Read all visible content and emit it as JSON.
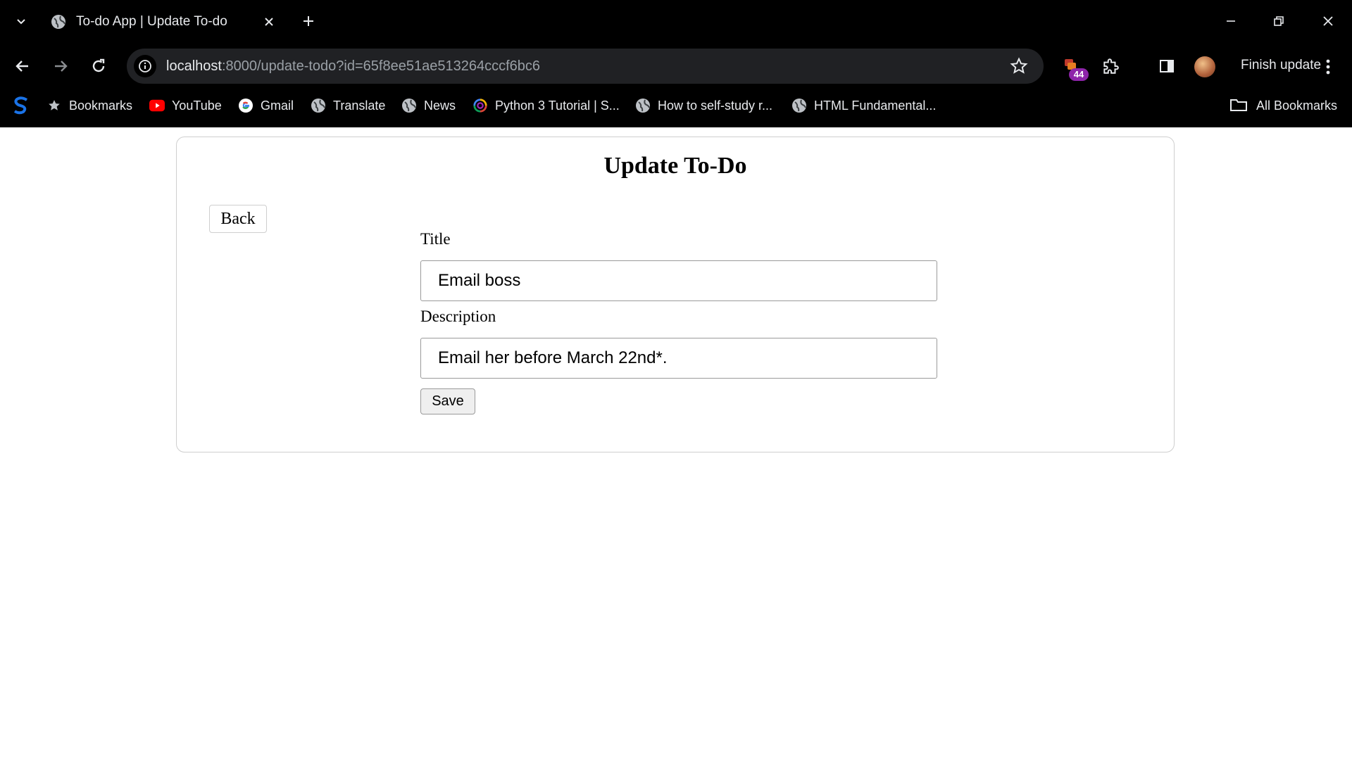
{
  "browser": {
    "tab": {
      "title": "To-do App | Update To-do"
    },
    "address": {
      "host": "localhost",
      "rest": ":8000/update-todo?id=65f8ee51ae513264cccf6bc6"
    },
    "extensions_badge": "44",
    "finish_update_label": "Finish update",
    "bookmarks": [
      {
        "label": "Bookmarks",
        "icon": "star-icon"
      },
      {
        "label": "YouTube",
        "icon": "youtube-icon"
      },
      {
        "label": "Gmail",
        "icon": "google-icon"
      },
      {
        "label": "Translate",
        "icon": "globe-icon"
      },
      {
        "label": "News",
        "icon": "globe-icon"
      },
      {
        "label": "Python 3 Tutorial | S...",
        "icon": "swirl-icon"
      },
      {
        "label": "How to self-study r...",
        "icon": "globe-icon"
      },
      {
        "label": "HTML Fundamental...",
        "icon": "globe-icon"
      }
    ],
    "all_bookmarks_label": "All Bookmarks"
  },
  "page": {
    "heading": "Update To-Do",
    "back_label": "Back",
    "title_label": "Title",
    "title_value": "Email boss",
    "description_label": "Description",
    "description_value": "Email her before March 22nd*.",
    "save_label": "Save"
  }
}
